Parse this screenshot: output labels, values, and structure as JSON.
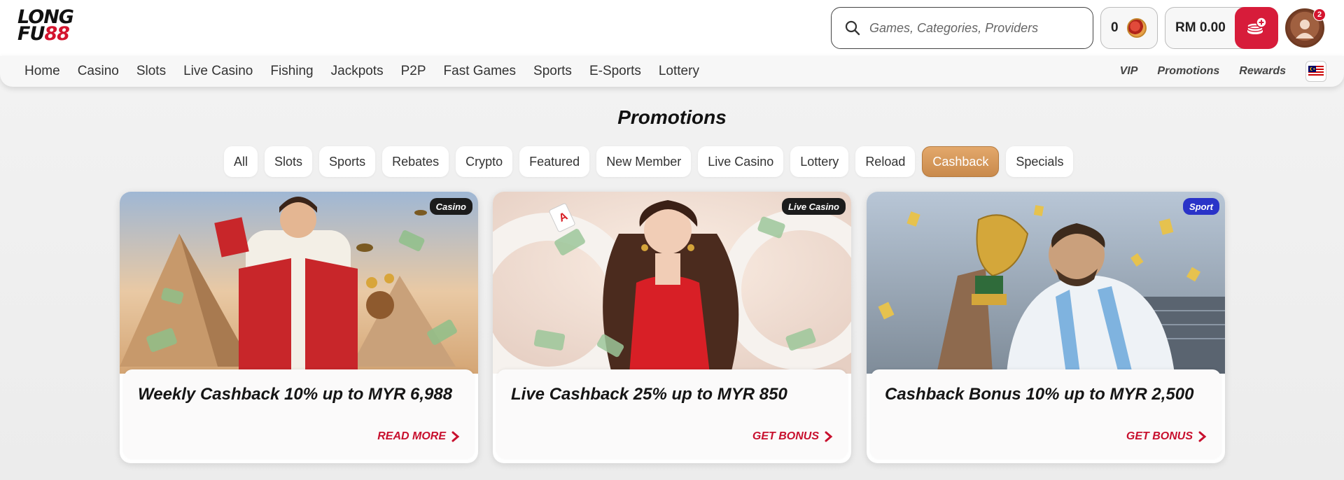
{
  "header": {
    "logo_line1": "LONG",
    "logo_line2_a": "FU",
    "logo_line2_b": "88",
    "search_placeholder": "Games, Categories, Providers",
    "coins": "0",
    "balance": "RM 0.00",
    "notification_count": "2"
  },
  "nav": {
    "left": [
      "Home",
      "Casino",
      "Slots",
      "Live Casino",
      "Fishing",
      "Jackpots",
      "P2P",
      "Fast Games",
      "Sports",
      "E-Sports",
      "Lottery"
    ],
    "right": [
      "VIP",
      "Promotions",
      "Rewards"
    ]
  },
  "page": {
    "title": "Promotions",
    "filters": [
      "All",
      "Slots",
      "Sports",
      "Rebates",
      "Crypto",
      "Featured",
      "New Member",
      "Live Casino",
      "Lottery",
      "Reload",
      "Cashback",
      "Specials"
    ],
    "active_filter": "Cashback"
  },
  "cards": [
    {
      "tag": "Casino",
      "title": "Weekly Cashback 10% up to MYR 6,988",
      "cta": "READ MORE"
    },
    {
      "tag": "Live Casino",
      "title": "Live Cashback 25% up to MYR 850",
      "cta": "GET BONUS"
    },
    {
      "tag": "Sport",
      "title": "Cashback Bonus 10% up to MYR 2,500",
      "cta": "GET BONUS"
    }
  ],
  "colors": {
    "brand_red": "#d71c3a",
    "active_pill": "#d49a5c",
    "cta_red": "#c8102e",
    "sport_tag": "#2a33c8"
  },
  "icons": {
    "search": "search-icon",
    "coin": "coin-icon",
    "deposit": "wallet-plus-icon",
    "avatar": "user-avatar-icon",
    "flag": "malaysia-flag-icon",
    "chevron": "chevron-right-icon"
  }
}
